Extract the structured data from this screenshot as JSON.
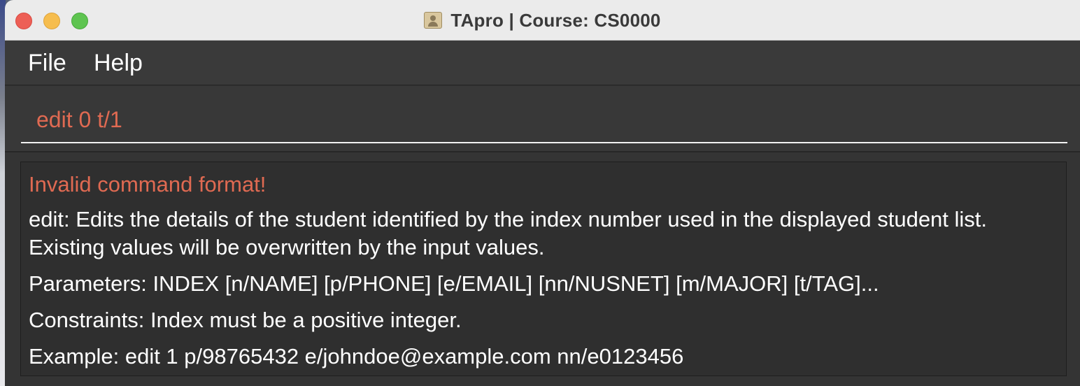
{
  "window": {
    "title": "TApro | Course: CS0000",
    "app_icon": "contact-card-icon"
  },
  "menu": {
    "items": [
      {
        "label": "File"
      },
      {
        "label": "Help"
      }
    ]
  },
  "command_box": {
    "value": "edit 0 t/1",
    "text_color": "#e06a52"
  },
  "result": {
    "error_title": "Invalid command format!",
    "description_line1": "edit: Edits the details of the student identified by the index number used in the displayed student list.",
    "description_line2": "Existing values will be overwritten by the input values.",
    "parameters": "Parameters: INDEX [n/NAME] [p/PHONE] [e/EMAIL] [nn/NUSNET] [m/MAJOR] [t/TAG]...",
    "constraints": "Constraints: Index must be a positive integer.",
    "example": "Example: edit 1 p/98765432 e/johndoe@example.com nn/e0123456"
  },
  "colors": {
    "error_accent": "#e06a52",
    "background": "#2f2f2f"
  }
}
